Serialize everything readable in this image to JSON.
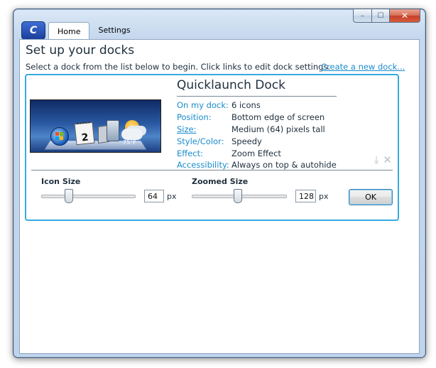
{
  "window": {
    "controls": {
      "minimize": "–",
      "maximize": "☐",
      "close": "✕"
    }
  },
  "app": {
    "logo_text": "C"
  },
  "tabs": [
    {
      "label": "Home",
      "active": true
    },
    {
      "label": "Settings",
      "active": false
    }
  ],
  "main": {
    "heading": "Set up your docks",
    "instructions": "Select a dock from the list below to begin. Click links to edit dock settings.",
    "create_link": "Create a new dock..."
  },
  "dock": {
    "name": "Quicklaunch Dock",
    "preview": {
      "calendar_day": "2",
      "weather_temp": "75°F"
    },
    "info": [
      {
        "label": "On my dock:",
        "value": "6 icons",
        "link": false
      },
      {
        "label": "Position:",
        "value": "Bottom edge of screen",
        "link": false
      },
      {
        "label": "Size:",
        "value": "Medium (64) pixels tall",
        "link": true
      },
      {
        "label": "Style/Color:",
        "value": "Speedy",
        "link": false
      },
      {
        "label": "Effect:",
        "value": "Zoom Effect",
        "link": false
      },
      {
        "label": "Accessibility:",
        "value": "Always on top & autohide",
        "link": false
      }
    ],
    "actions": {
      "download_icon": "download-icon",
      "delete_icon": "delete-icon"
    },
    "icon_size": {
      "label": "Icon Size",
      "value": "64",
      "unit": "px"
    },
    "zoomed_size": {
      "label": "Zoomed Size",
      "value": "128",
      "unit": "px"
    },
    "ok_label": "OK"
  },
  "colors": {
    "accent": "#35abdf",
    "link": "#1a8ccc"
  }
}
